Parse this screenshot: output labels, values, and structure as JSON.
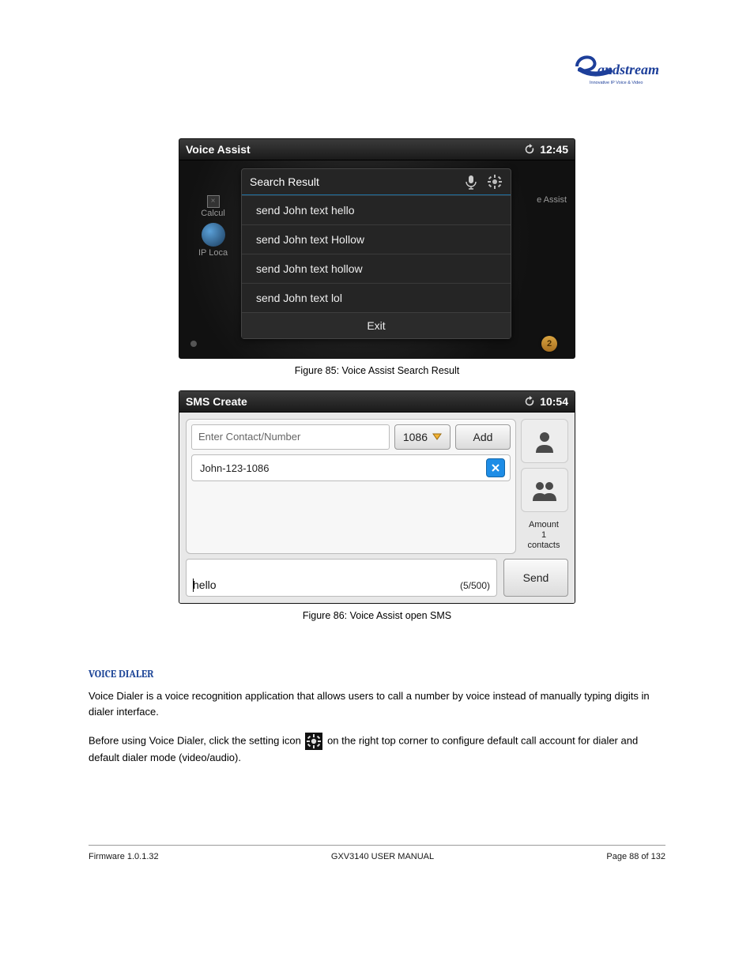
{
  "logo": {
    "word": "andstream",
    "tag": "Innovative IP Voice & Video"
  },
  "screenshot1": {
    "statusbar": {
      "title": "Voice Assist",
      "time": "12:45"
    },
    "bg": {
      "calc": "Calcul",
      "iploc": "IP Loca",
      "eassist": "e Assist"
    },
    "panel": {
      "title": "Search Result",
      "items": [
        "send John text hello",
        "send John text Hollow",
        "send John text hollow",
        "send John text lol"
      ],
      "exit": "Exit"
    },
    "badge": "2"
  },
  "caption1": "Figure 85: Voice Assist Search Result",
  "screenshot2": {
    "statusbar": {
      "title": "SMS Create",
      "time": "10:54"
    },
    "contactPlaceholder": "Enter Contact/Number",
    "account": "1086",
    "addBtn": "Add",
    "chip": "John-123-1086",
    "amountLabel": "Amount",
    "amountValue": "1",
    "contactsLabel": "contacts",
    "msg": "hello",
    "counter": "(5/500)",
    "sendBtn": "Send"
  },
  "caption2": "Figure 86: Voice Assist open SMS",
  "sectionTitle": "VOICE DIALER",
  "body1": "Voice Dialer is a voice recognition application that allows users to call a number by voice instead of manually typing digits in dialer interface.",
  "body2a": "Before using Voice Dialer, click the setting icon ",
  "body2b": " on the right top corner to configure default call account for dialer and default dialer mode (video/audio).",
  "footer": {
    "left": "Firmware 1.0.1.32",
    "centerTop": "GXV3140 USER MANUAL",
    "centerBottom": "",
    "right": "Page 88 of 132"
  }
}
